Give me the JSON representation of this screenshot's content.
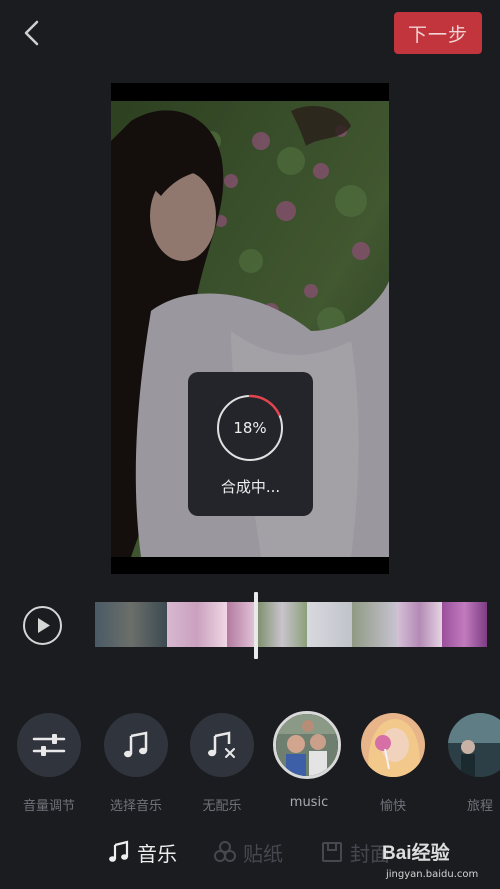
{
  "header": {
    "next_label": "下一步"
  },
  "progress": {
    "percent_text": "18%",
    "value": 0.18,
    "status": "合成中..."
  },
  "tools": [
    {
      "label": "音量调节",
      "icon": "sliders-icon"
    },
    {
      "label": "选择音乐",
      "icon": "music-note-icon"
    },
    {
      "label": "无配乐",
      "icon": "music-off-icon"
    },
    {
      "label": "music",
      "icon": "thumbnail"
    },
    {
      "label": "愉快",
      "icon": "thumbnail"
    },
    {
      "label": "旅程",
      "icon": "thumbnail"
    }
  ],
  "tabs": [
    {
      "label": "音乐",
      "icon": "music-note-icon",
      "active": true
    },
    {
      "label": "贴纸",
      "icon": "sticker-icon",
      "active": false
    },
    {
      "label": "封面",
      "icon": "cover-icon",
      "active": false
    }
  ],
  "watermark": {
    "main": "Bai经验",
    "sub": "jingyan.baidu.com"
  },
  "colors": {
    "accent": "#c3353d",
    "background": "#1b1c20",
    "tool_bg": "#30343d",
    "label": "#6f7279"
  }
}
